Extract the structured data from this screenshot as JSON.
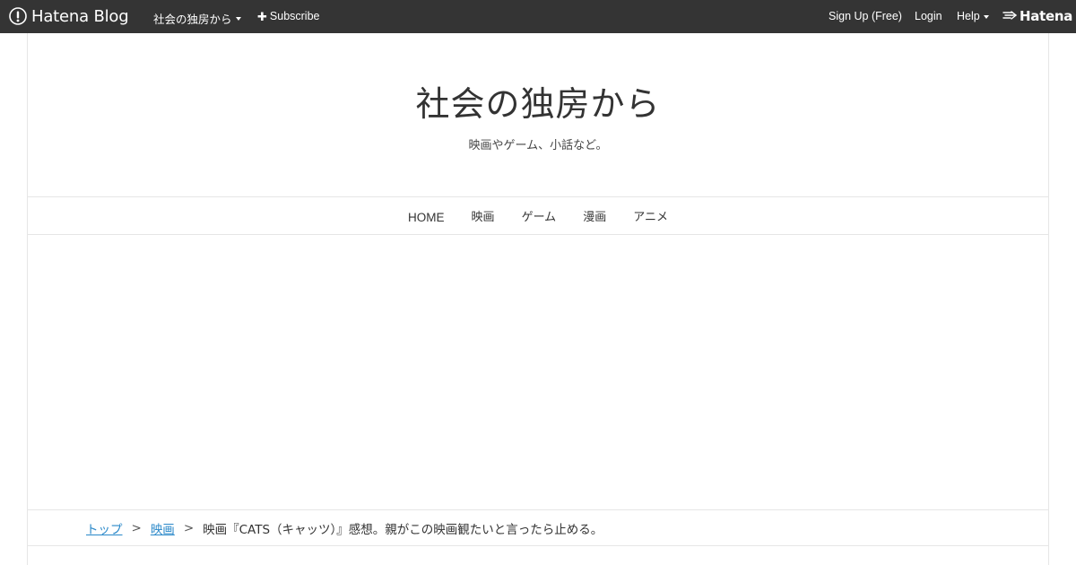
{
  "globalbar": {
    "logo_text": "Hatena Blog",
    "blog_menu_label": "社会の独房から",
    "subscribe_label": "Subscribe",
    "signup_label": "Sign Up (Free)",
    "login_label": "Login",
    "help_label": "Help",
    "hatena_label": "Hatena"
  },
  "header": {
    "title": "社会の独房から",
    "description": "映画やゲーム、小話など。"
  },
  "nav": {
    "items": [
      "HOME",
      "映画",
      "ゲーム",
      "漫画",
      "アニメ"
    ]
  },
  "breadcrumb": {
    "top": "トップ",
    "category": "映画",
    "separator": ">",
    "current": "映画『CATS（キャッツ）』感想。親がこの映画観たいと言ったら止める。"
  },
  "colors": {
    "globalbar_bg": "#343434",
    "link": "#2a88c9",
    "border": "#e6e6e6"
  }
}
